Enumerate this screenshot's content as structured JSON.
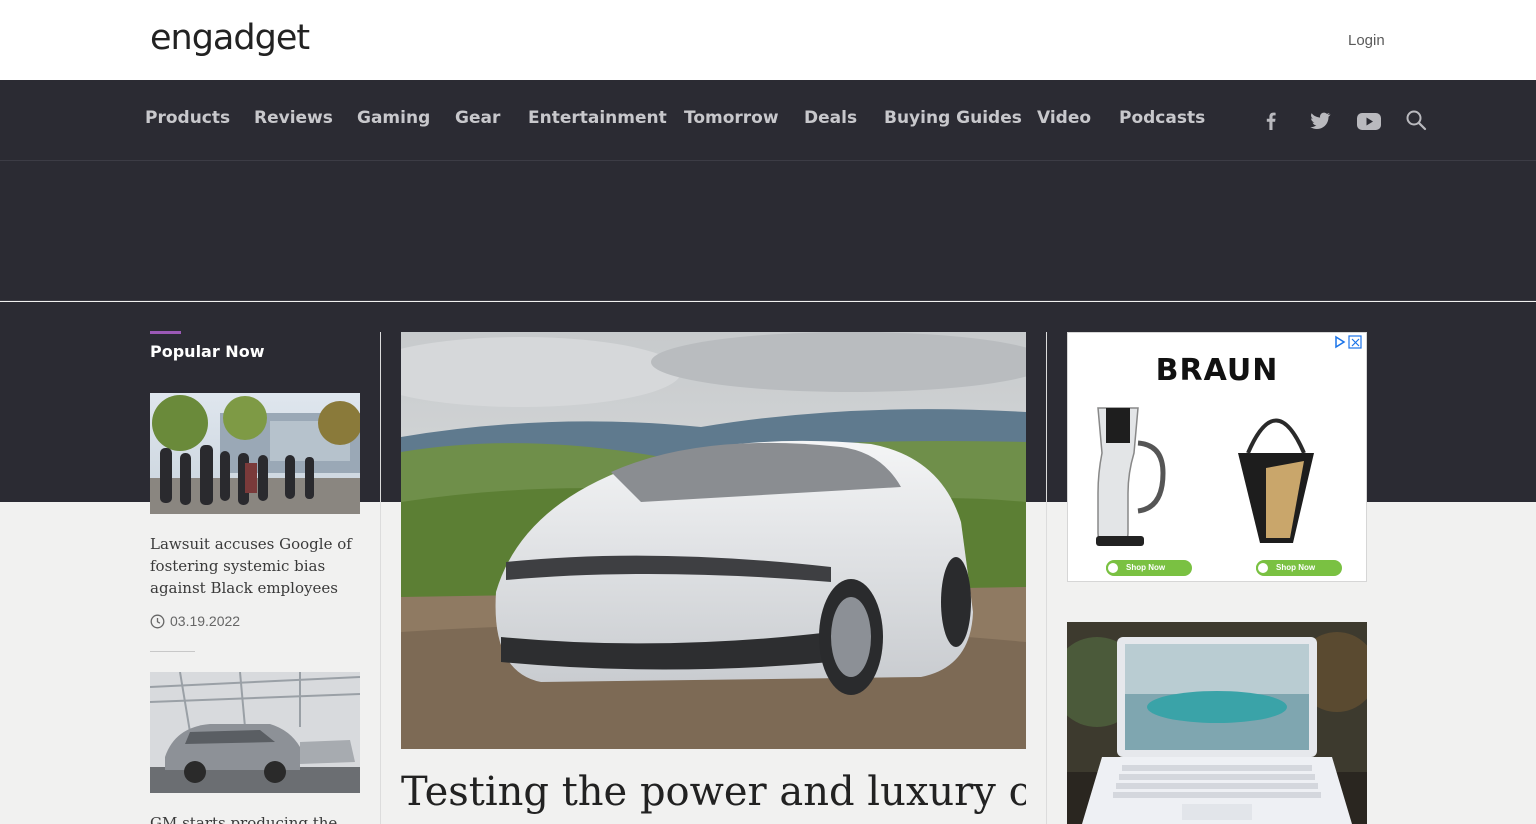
{
  "header": {
    "logo": "engadget",
    "login_label": "Login"
  },
  "nav": {
    "items": [
      "Products",
      "Reviews",
      "Gaming",
      "Gear",
      "Entertainment",
      "Tomorrow",
      "Deals",
      "Buying Guides",
      "Video",
      "Podcasts"
    ],
    "social": [
      "facebook-icon",
      "twitter-icon",
      "youtube-icon",
      "search-icon"
    ]
  },
  "popular": {
    "heading": "Popular Now",
    "stories": [
      {
        "title": "Lawsuit accuses Google of fostering systemic bias against Black employees",
        "date": "03.19.2022"
      },
      {
        "title": "GM starts producing the"
      }
    ]
  },
  "hero": {
    "title": "Testing the power and luxury of"
  },
  "ads": {
    "brand": "BRAUN",
    "shop_label_1": "Shop Now",
    "shop_label_2": "Shop Now"
  },
  "colors": {
    "nav_bg": "#2b2b33",
    "accent": "#9b59b6",
    "shop_green": "#7ac142"
  }
}
